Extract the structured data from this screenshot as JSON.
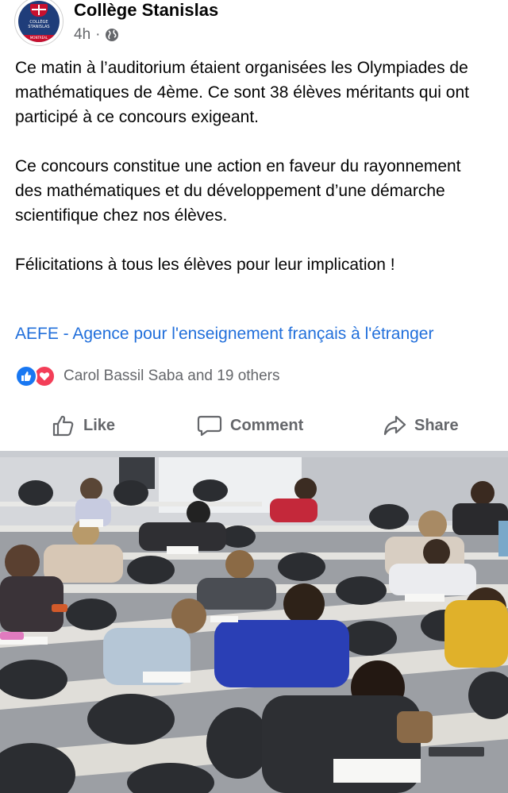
{
  "post": {
    "page_name": "Collège Stanislas",
    "time": "4h",
    "separator": "·",
    "audience_icon": "globe-icon",
    "paragraphs": [
      "Ce matin à l’auditorium étaient organisées les Olympiades de mathématiques de 4ème. Ce sont 38 élèves méritants qui ont participé à ce concours exigeant.",
      "Ce concours constitue une action en faveur du rayonnement des mathématiques et du développement d’une démarche scientifique chez nos élèves.",
      "Félicitations à tous les élèves pour leur implication !"
    ],
    "tagged_link": "AEFE - Agence pour l'enseignement français à l'étranger",
    "reactions": {
      "icons": [
        "like-reaction-icon",
        "love-reaction-icon"
      ],
      "summary": "Carol Bassil Saba and 19 others"
    },
    "actions": {
      "like": "Like",
      "comment": "Comment",
      "share": "Share"
    },
    "avatar": {
      "line1": "COLLÈGE",
      "line2": "STANISLAS",
      "line3": "MONTRÉAL"
    }
  },
  "colors": {
    "link": "#216fdb",
    "secondary_text": "#65676b",
    "like_blue": "#1877f2",
    "love_red": "#f33e58",
    "separator": "#c9ccd1"
  }
}
